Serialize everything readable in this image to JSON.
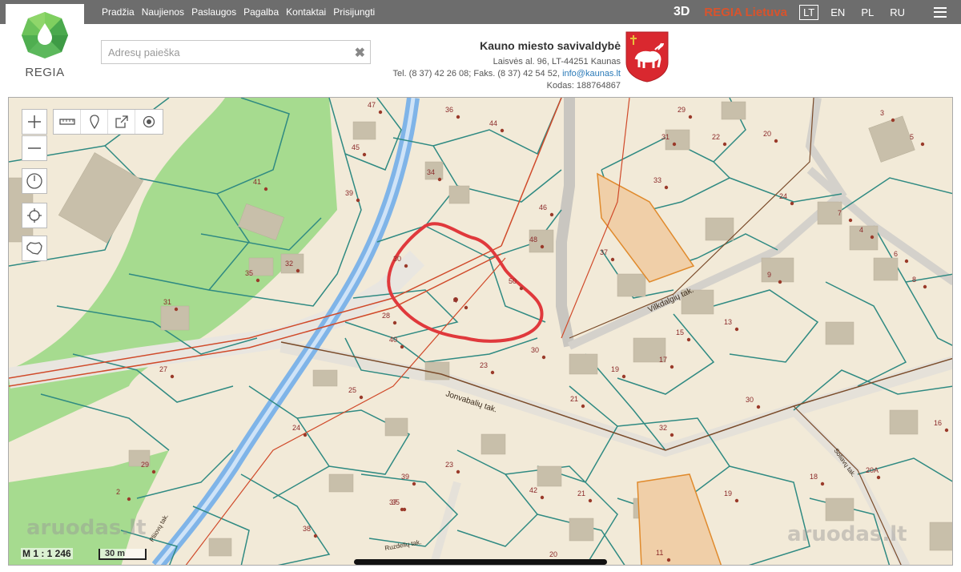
{
  "nav": {
    "items": [
      "Pradžia",
      "Naujienos",
      "Paslaugos",
      "Pagalba",
      "Kontaktai",
      "Prisijungti"
    ],
    "btn_3d": "3D",
    "brand": "REGIA Lietuva",
    "languages": [
      "LT",
      "EN",
      "PL",
      "RU"
    ],
    "active_language": "LT"
  },
  "logo": {
    "text": "REGIA"
  },
  "search": {
    "placeholder": "Adresų paieška"
  },
  "municipality": {
    "name": "Kauno miesto savivaldybė",
    "address": "Laisvės al. 96, LT-44251 Kaunas",
    "phone_prefix": "Tel. (8 37) 42 26 08; Faks. (8 37) 42 54 52,",
    "email": "info@kaunas.lt",
    "code": "Kodas: 188764867"
  },
  "map": {
    "scale_label": "M 1 : 1 246",
    "scale_bar": "30 m",
    "watermark": "aruodas.lt",
    "streets": [
      "Vilkdalgių tak.",
      "Jonvabalių tak.",
      "Pliiovų tak.",
      "Ruzdelių tak.",
      "Soliavų tak."
    ],
    "parcel_numbers": [
      "47",
      "36",
      "44",
      "29",
      "3",
      "45",
      "34",
      "31",
      "22",
      "20",
      "5",
      "41",
      "39",
      "33",
      "46",
      "24",
      "7",
      "4",
      "6",
      "30",
      "48",
      "37",
      "35",
      "32",
      "50",
      "27",
      "9",
      "8",
      "31",
      "4",
      "28",
      "40",
      "30",
      "13",
      "15",
      "19",
      "17",
      "23",
      "25",
      "21",
      "30",
      "24",
      "32",
      "16",
      "20A",
      "29",
      "39",
      "42",
      "21",
      "19",
      "23",
      "35",
      "38",
      "20",
      "11",
      "2",
      "37",
      "18"
    ],
    "tools": [
      "measure-icon",
      "marker-icon",
      "share-icon",
      "locate-icon"
    ],
    "colors": {
      "parcel_fill": "#f2ead8",
      "parcel_line": "#2f8a82",
      "green": "#9fd98a",
      "canal": "#7fb4e8",
      "highlight": "#e0393c",
      "power_line": "#d04a2a"
    }
  }
}
